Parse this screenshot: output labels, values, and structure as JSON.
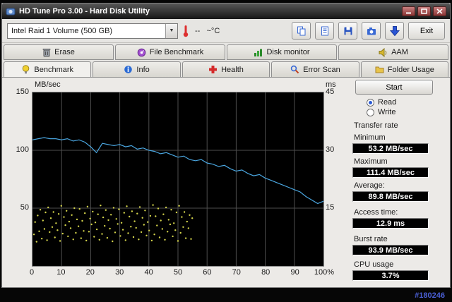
{
  "desktop": {
    "watermark": "#180246"
  },
  "window": {
    "title": "HD Tune Pro 3.00 - Hard Disk Utility"
  },
  "toolbar": {
    "drive_select": {
      "value": "Intel Raid 1 Volume (500 GB)"
    },
    "temperature": "--   ~°C",
    "exit_label": "Exit"
  },
  "tabs_row1": [
    {
      "label": "Erase",
      "icon": "trash-icon"
    },
    {
      "label": "File Benchmark",
      "icon": "gauge-icon"
    },
    {
      "label": "Disk monitor",
      "icon": "chart-icon"
    },
    {
      "label": "AAM",
      "icon": "speaker-icon"
    }
  ],
  "tabs_row2": [
    {
      "label": "Benchmark",
      "icon": "lamp-icon",
      "active": true
    },
    {
      "label": "Info",
      "icon": "info-icon",
      "active": false
    },
    {
      "label": "Health",
      "icon": "health-cross-icon",
      "active": false
    },
    {
      "label": "Error Scan",
      "icon": "magnifier-icon",
      "active": false
    },
    {
      "label": "Folder Usage",
      "icon": "folder-icon",
      "active": false
    }
  ],
  "benchmark": {
    "start_label": "Start",
    "mode": {
      "read_label": "Read",
      "write_label": "Write",
      "selected": "Read"
    },
    "results": {
      "transfer_rate_heading": "Transfer rate",
      "minimum_label": "Minimum",
      "minimum_value": "53.2 MB/sec",
      "maximum_label": "Maximum",
      "maximum_value": "111.4 MB/sec",
      "average_label": "Average:",
      "average_value": "89.8 MB/sec",
      "access_time_label": "Access time:",
      "access_time_value": "12.9 ms",
      "burst_rate_label": "Burst rate",
      "burst_rate_value": "93.9 MB/sec",
      "cpu_usage_label": "CPU usage",
      "cpu_usage_value": "3.7%"
    }
  },
  "chart_data": {
    "type": "line",
    "title": "HD Tune read benchmark: transfer rate (line) and access time (scatter) vs position on disk",
    "background": "#000000",
    "grid": true,
    "x_axis": {
      "min": 0,
      "max": 100,
      "ticks": [
        0,
        10,
        20,
        30,
        40,
        50,
        60,
        70,
        80,
        90,
        100
      ],
      "tick_labels": [
        "0",
        "10",
        "20",
        "30",
        "40",
        "50",
        "60",
        "70",
        "80",
        "90",
        "100%"
      ]
    },
    "left_axis": {
      "label": "MB/sec",
      "min": 0,
      "max": 150,
      "tick_labels": [
        "150",
        "100",
        "50"
      ],
      "grid_values": [
        100,
        50
      ]
    },
    "right_axis": {
      "label": "ms",
      "min": 0,
      "max": 45,
      "tick_labels": [
        "45",
        "30",
        "15"
      ]
    },
    "series": [
      {
        "name": "transfer-rate",
        "type": "line",
        "axis": "left",
        "color": "#4aa6e0",
        "x": [
          0,
          2,
          4,
          6,
          8,
          10,
          12,
          14,
          16,
          18,
          20,
          22,
          24,
          26,
          28,
          30,
          32,
          34,
          36,
          38,
          40,
          42,
          44,
          46,
          48,
          50,
          52,
          54,
          56,
          58,
          60,
          62,
          64,
          66,
          68,
          70,
          72,
          74,
          76,
          78,
          80,
          82,
          84,
          86,
          88,
          90,
          92,
          94,
          96,
          98,
          100
        ],
        "values": [
          109,
          110,
          111,
          110,
          110,
          109,
          110,
          108,
          109,
          107,
          103,
          98,
          106,
          105,
          104,
          105,
          103,
          104,
          101,
          102,
          100,
          99,
          97,
          98,
          96,
          94,
          95,
          92,
          91,
          92,
          89,
          88,
          86,
          87,
          84,
          82,
          83,
          80,
          78,
          79,
          76,
          74,
          72,
          70,
          68,
          66,
          64,
          60,
          57,
          54,
          56
        ]
      },
      {
        "name": "access-time",
        "type": "scatter",
        "axis": "right",
        "color": "#d2d24a",
        "points": [
          [
            0.5,
            8.2
          ],
          [
            0.9,
            11.4
          ],
          [
            1.4,
            6.3
          ],
          [
            1.8,
            13.1
          ],
          [
            2.3,
            9.0
          ],
          [
            2.7,
            14.6
          ],
          [
            3.2,
            7.1
          ],
          [
            3.6,
            11.8
          ],
          [
            4.1,
            9.6
          ],
          [
            4.5,
            13.9
          ],
          [
            5.0,
            6.7
          ],
          [
            5.4,
            15.2
          ],
          [
            5.9,
            8.8
          ],
          [
            6.3,
            12.4
          ],
          [
            6.8,
            10.1
          ],
          [
            7.2,
            14.0
          ],
          [
            7.7,
            7.4
          ],
          [
            8.1,
            11.1
          ],
          [
            8.6,
            9.3
          ],
          [
            9.0,
            13.5
          ],
          [
            9.5,
            6.5
          ],
          [
            9.9,
            15.6
          ],
          [
            10.4,
            8.4
          ],
          [
            10.8,
            12.7
          ],
          [
            11.3,
            10.6
          ],
          [
            11.7,
            14.3
          ],
          [
            12.2,
            7.7
          ],
          [
            12.6,
            11.5
          ],
          [
            13.1,
            9.8
          ],
          [
            13.5,
            13.2
          ],
          [
            14.0,
            6.9
          ],
          [
            14.4,
            15.0
          ],
          [
            14.9,
            8.6
          ],
          [
            15.3,
            12.1
          ],
          [
            15.8,
            10.3
          ],
          [
            16.2,
            14.8
          ],
          [
            16.7,
            7.2
          ],
          [
            17.1,
            11.7
          ],
          [
            17.6,
            9.1
          ],
          [
            18.0,
            13.7
          ],
          [
            18.5,
            6.6
          ],
          [
            18.9,
            15.4
          ],
          [
            19.4,
            8.9
          ],
          [
            19.8,
            12.3
          ],
          [
            20.3,
            10.8
          ],
          [
            20.7,
            14.1
          ],
          [
            21.2,
            7.6
          ],
          [
            21.6,
            11.3
          ],
          [
            22.1,
            9.5
          ],
          [
            22.5,
            13.4
          ],
          [
            23.0,
            6.8
          ],
          [
            23.4,
            15.7
          ],
          [
            23.9,
            8.3
          ],
          [
            24.3,
            12.6
          ],
          [
            24.8,
            10.4
          ],
          [
            25.2,
            14.5
          ],
          [
            25.7,
            7.3
          ],
          [
            26.1,
            11.9
          ],
          [
            26.6,
            9.7
          ],
          [
            27.0,
            13.3
          ],
          [
            27.5,
            6.4
          ],
          [
            27.9,
            15.1
          ],
          [
            28.4,
            8.7
          ],
          [
            28.8,
            12.2
          ],
          [
            29.3,
            10.9
          ],
          [
            29.7,
            14.7
          ],
          [
            30.2,
            7.8
          ],
          [
            30.6,
            11.2
          ],
          [
            31.1,
            9.4
          ],
          [
            31.5,
            13.8
          ],
          [
            32.0,
            6.7
          ],
          [
            32.4,
            15.5
          ],
          [
            32.9,
            8.5
          ],
          [
            33.3,
            12.8
          ],
          [
            33.8,
            10.2
          ],
          [
            34.2,
            14.2
          ],
          [
            34.7,
            7.5
          ],
          [
            35.1,
            11.6
          ],
          [
            35.6,
            9.9
          ],
          [
            36.0,
            13.6
          ],
          [
            36.5,
            6.9
          ],
          [
            36.9,
            15.3
          ],
          [
            37.4,
            8.8
          ],
          [
            37.8,
            12.5
          ],
          [
            38.3,
            10.7
          ],
          [
            38.7,
            14.4
          ],
          [
            39.2,
            7.9
          ],
          [
            39.6,
            11.4
          ],
          [
            40.1,
            9.2
          ],
          [
            40.5,
            13.0
          ],
          [
            41.0,
            6.6
          ],
          [
            41.4,
            15.8
          ],
          [
            41.9,
            8.2
          ],
          [
            42.3,
            12.9
          ],
          [
            42.8,
            10.5
          ],
          [
            43.2,
            14.9
          ],
          [
            43.7,
            7.4
          ],
          [
            44.1,
            11.8
          ],
          [
            44.6,
            9.6
          ],
          [
            45.0,
            13.4
          ],
          [
            45.5,
            6.8
          ],
          [
            45.9,
            15.2
          ],
          [
            46.4,
            8.9
          ],
          [
            46.8,
            12.0
          ],
          [
            47.3,
            10.8
          ],
          [
            47.7,
            14.6
          ],
          [
            48.2,
            7.7
          ],
          [
            48.6,
            11.1
          ],
          [
            49.1,
            9.3
          ],
          [
            49.5,
            13.9
          ],
          [
            50.0,
            6.5
          ],
          [
            50.4,
            15.6
          ],
          [
            50.9,
            8.6
          ],
          [
            51.3,
            12.7
          ],
          [
            51.8,
            10.1
          ],
          [
            52.2,
            14.0
          ],
          [
            52.7,
            7.2
          ],
          [
            53.1,
            11.5
          ],
          [
            53.6,
            9.8
          ],
          [
            54.0,
            13.2
          ],
          [
            54.5,
            7.0
          ],
          [
            54.9,
            12.4
          ]
        ]
      }
    ]
  }
}
